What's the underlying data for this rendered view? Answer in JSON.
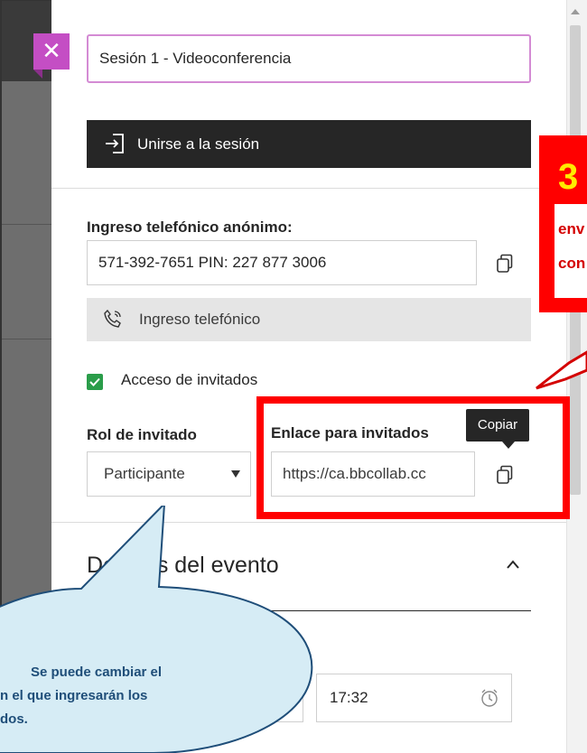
{
  "session": {
    "title_value": "Sesión 1 - Videoconferencia",
    "join_label": "Unirse a la sesión"
  },
  "phone": {
    "heading": "Ingreso telefónico anónimo:",
    "number_value": "571-392-7651 PIN: 227 877 3006",
    "button_label": "Ingreso telefónico"
  },
  "guest": {
    "access_label": "Acceso de invitados",
    "access_checked": true,
    "role_heading": "Rol de invitado",
    "role_value": "Participante",
    "link_heading": "Enlace para invitados",
    "link_value": "https://ca.bbcollab.cc",
    "tooltip": "Copiar"
  },
  "event": {
    "section_title": "Detalles del evento",
    "time_value": "17:32"
  },
  "annotations": {
    "step_number": "3",
    "step_text_lines": [
      "env",
      "con"
    ],
    "bubble_lines": [
      "Se puede cambiar el",
      "n el que ingresarán los",
      "dos."
    ],
    "highlight_color": "#ff0000",
    "step_number_color": "#ffeb00",
    "bubble_fill": "#d6ecf5",
    "bubble_stroke": "#1f4e79"
  },
  "colors": {
    "close_button": "#c44ec4",
    "join_button": "#262626",
    "checkbox": "#2a9d4a"
  },
  "icons": [
    "close-icon",
    "join-icon",
    "copy-icon",
    "phone-icon",
    "check-icon",
    "dropdown-arrow-icon",
    "chevron-up-icon",
    "clock-icon"
  ]
}
